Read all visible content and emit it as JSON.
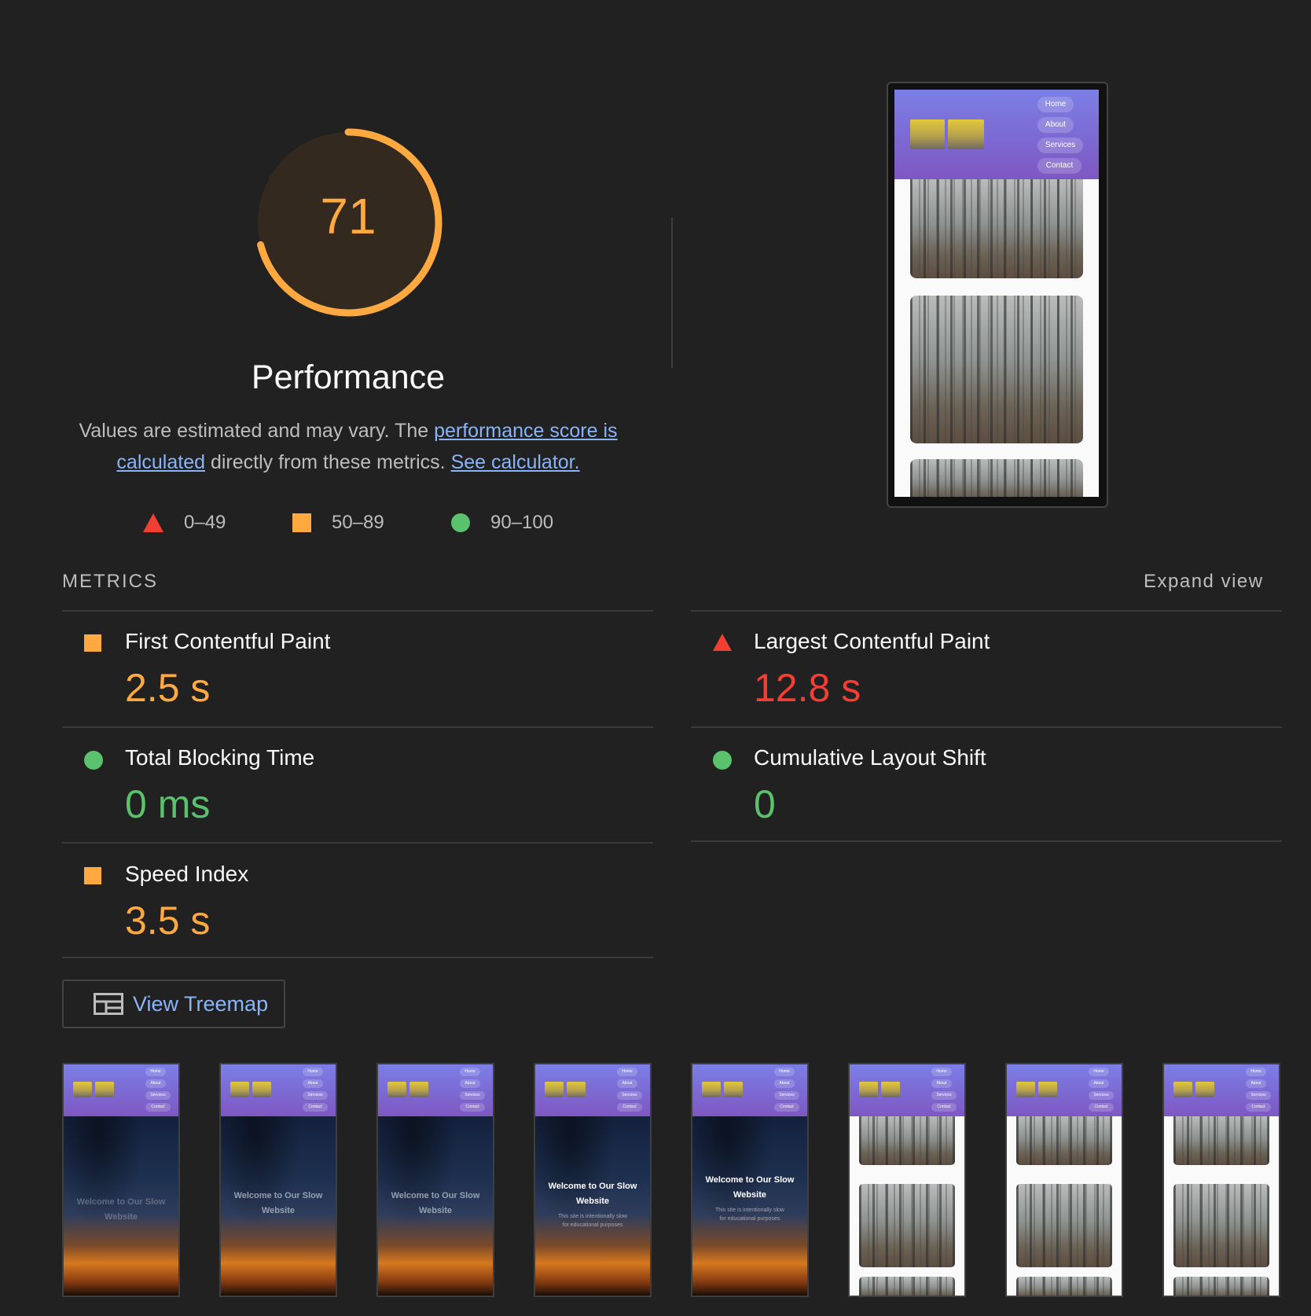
{
  "score": {
    "value": "71",
    "fraction": 0.71,
    "color": "#ffa940",
    "title": "Performance",
    "desc_pre": "Values are estimated and may vary. The ",
    "desc_link1": "performance score is calculated",
    "desc_mid": " directly from these metrics. ",
    "desc_link2": "See calculator."
  },
  "legend": [
    {
      "shape": "triangle",
      "label": "0–49",
      "color": "#f33f33"
    },
    {
      "shape": "square",
      "label": "50–89",
      "color": "#ffa940"
    },
    {
      "shape": "circle",
      "label": "90–100",
      "color": "#5ac16c"
    }
  ],
  "preview": {
    "nav": [
      "Home",
      "About",
      "Services",
      "Contact"
    ]
  },
  "metrics": {
    "section_label": "METRICS",
    "expand_label": "Expand view",
    "items": [
      {
        "title": "First Contentful Paint",
        "value": "2.5 s",
        "rating": "average",
        "icon": "square-icon"
      },
      {
        "title": "Largest Contentful Paint",
        "value": "12.8 s",
        "rating": "fail",
        "icon": "triangle-icon"
      },
      {
        "title": "Total Blocking Time",
        "value": "0 ms",
        "rating": "pass",
        "icon": "circle-icon"
      },
      {
        "title": "Cumulative Layout Shift",
        "value": "0",
        "rating": "pass",
        "icon": "circle-icon"
      },
      {
        "title": "Speed Index",
        "value": "3.5 s",
        "rating": "average",
        "icon": "square-icon"
      }
    ]
  },
  "treemap": {
    "label": "View Treemap",
    "icon": "treemap-icon"
  },
  "filmstrip": {
    "welcome": "Welcome to Our Slow Website",
    "subtitle": "This site is intentionally slow for educational purposes",
    "frames": [
      "hero-faded",
      "hero-faded",
      "hero-faded",
      "hero-subtitle",
      "hero-subtitle",
      "gallery",
      "gallery",
      "gallery"
    ]
  }
}
